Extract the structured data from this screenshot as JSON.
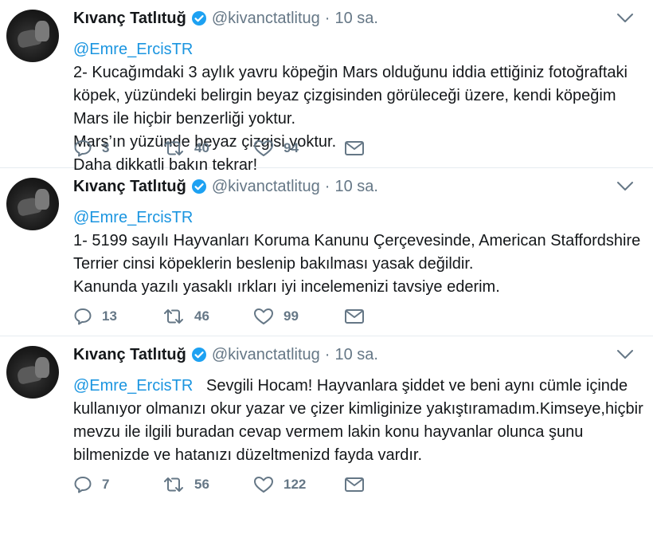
{
  "colors": {
    "link": "#1b95e0",
    "muted": "#657786",
    "verified": "#1da1f2",
    "text": "#14171a"
  },
  "tweets": [
    {
      "author_name": "Kıvanç Tatlıtuğ",
      "handle": "@kivanctatlitug",
      "time": "10 sa.",
      "reply_to": "@Emre_ErcisTR",
      "lines": [
        "2- Kucağımdaki 3 aylık yavru köpeğin Mars olduğunu iddia ettiğiniz fotoğraftaki",
        "köpek,  yüzündeki belirgin beyaz çizgisinden görüleceği üzere, kendi köpeğim",
        "Mars ile hiçbir benzerliği yoktur.",
        "Mars’ın yüzünde beyaz çizgisi yoktur.",
        "Daha dikkatli bakın tekrar!"
      ],
      "replies": "3",
      "retweets": "40",
      "likes": "94"
    },
    {
      "author_name": "Kıvanç Tatlıtuğ",
      "handle": "@kivanctatlitug",
      "time": "10 sa.",
      "reply_to": "@Emre_ErcisTR",
      "lines": [
        "1- 5199 sayılı Hayvanları Koruma Kanunu Çerçevesinde, American Staffordshire",
        "Terrier cinsi köpeklerin beslenip bakılması yasak değildir.",
        "Kanunda yazılı yasaklı ırkları iyi incelemenizi tavsiye ederim."
      ],
      "replies": "13",
      "retweets": "46",
      "likes": "99"
    },
    {
      "author_name": "Kıvanç Tatlıtuğ",
      "handle": "@kivanctatlitug",
      "time": "10 sa.",
      "reply_to": "@Emre_ErcisTR",
      "first_line_rest": "Sevgili Hocam! Hayvanlara şiddet ve beni aynı cümle içinde",
      "lines": [
        "kullanıyor olmanızı okur yazar ve çizer kimliginize yakıştıramadım.Kimseye,hiçbir",
        "mevzu ile ilgili  buradan cevap vermem lakin konu hayvanlar olunca  şunu",
        "bilmenizde ve hatanızı düzeltmenizd fayda vardır."
      ],
      "replies": "7",
      "retweets": "56",
      "likes": "122"
    }
  ],
  "icons": {
    "verified": "verified-badge-icon",
    "caret": "chevron-down-icon",
    "reply": "reply-icon",
    "retweet": "retweet-icon",
    "like": "heart-icon",
    "dm": "envelope-icon"
  }
}
